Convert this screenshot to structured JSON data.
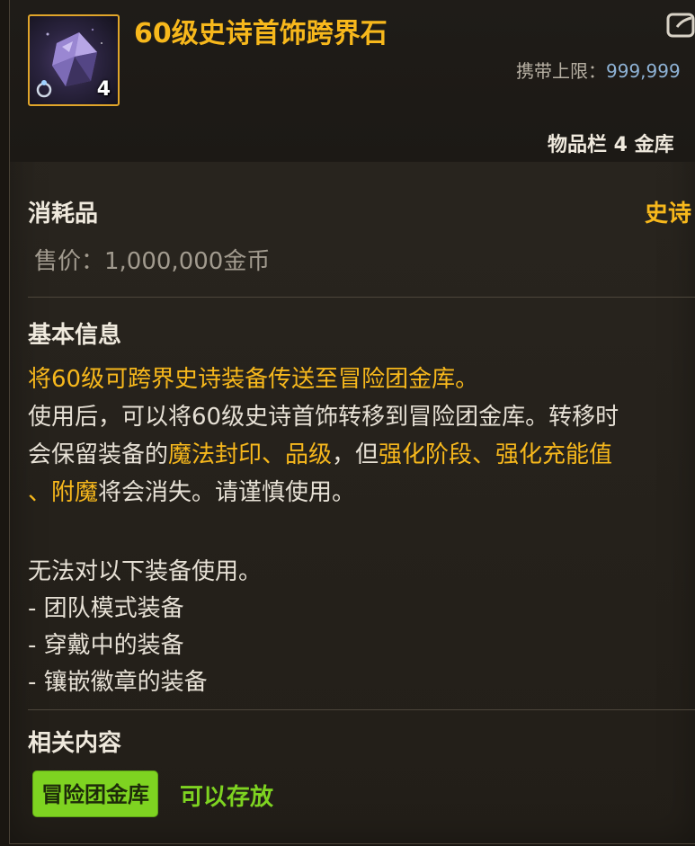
{
  "item": {
    "name": "60级史诗首饰跨界石",
    "stack_count": "4",
    "icon": "purple-crystal-ring-icon",
    "carry_limit_label": "携带上限：",
    "carry_limit_value": "999,999",
    "location": "物品栏 4 金库",
    "category": "消耗品",
    "rarity": "史诗",
    "price": "售价：1,000,000金币"
  },
  "basic_info": {
    "title": "基本信息",
    "highlight_line": "将60级可跨界史诗装备传送至冒险团金库。",
    "line2": "使用后，可以将60级史诗首饰转移到冒险团金库。转移时",
    "line3_a": "会保留装备的",
    "line3_b": "魔法封印、品级",
    "line3_c": "，但",
    "line3_d": "强化阶段、强化充能值",
    "line4_a": "、附魔",
    "line4_b": "将会消失。请谨慎使用。",
    "restriction_title": "无法对以下装备使用。",
    "restrictions": [
      "- 团队模式装备",
      "- 穿戴中的装备",
      "- 镶嵌徽章的装备"
    ]
  },
  "related": {
    "title": "相关内容",
    "tag_label": "冒险团金库",
    "tag_status": "可以存放"
  },
  "colors": {
    "gold": "#f7b81c",
    "green": "#7ed321",
    "blue_value": "#8fb3d6"
  }
}
